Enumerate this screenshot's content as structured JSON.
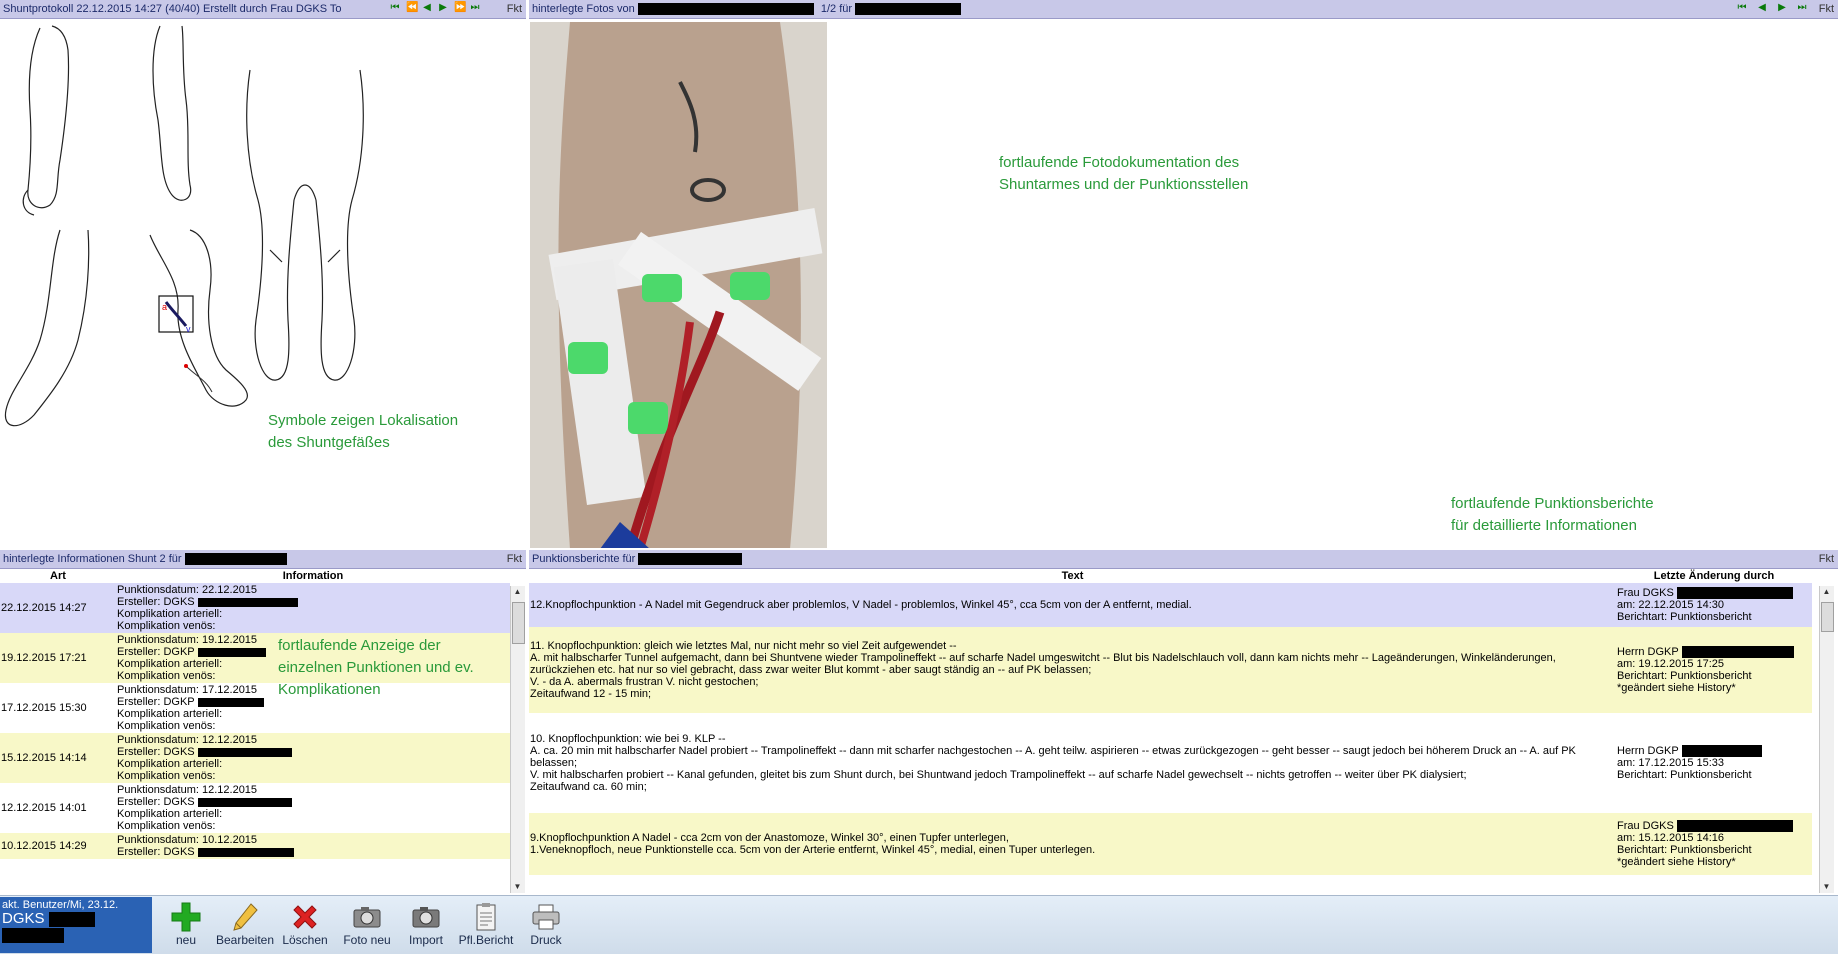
{
  "left_top": {
    "title": "Shuntprotokoll 22.12.2015 14:27 (40/40) Erstellt durch Frau DGKS To",
    "fkt": "Fkt",
    "annotation_line1": "Symbole zeigen Lokalisation",
    "annotation_line2": "des Shuntgefäßes"
  },
  "right_top": {
    "title_prefix": "hinterlegte Fotos von",
    "title_page": "1/2 für",
    "fkt": "Fkt",
    "annotation1_line1": "fortlaufende Fotodokumentation des",
    "annotation1_line2": "Shuntarmes und der Punktionsstellen",
    "annotation2_line1": "fortlaufende Punktionsberichte",
    "annotation2_line2": "für detaillierte Informationen"
  },
  "left_bottom": {
    "title": "hinterlegte Informationen Shunt 2 für",
    "fkt": "Fkt",
    "col_art": "Art",
    "col_info": "Information",
    "annotation_line1": "fortlaufende Anzeige der",
    "annotation_line2": "einzelnen Punktionen und ev.",
    "annotation_line3": "Komplikationen",
    "rows": [
      {
        "art": "22.12.2015 14:27",
        "l1": "Punktionsdatum: 22.12.2015",
        "l2": "Ersteller: DGKS",
        "l3": "Komplikation arteriell:",
        "l4": "Komplikation venös:"
      },
      {
        "art": "19.12.2015 17:21",
        "l1": "Punktionsdatum: 19.12.2015",
        "l2": "Ersteller: DGKP",
        "l3": "Komplikation arteriell:",
        "l4": "Komplikation venös:"
      },
      {
        "art": "17.12.2015 15:30",
        "l1": "Punktionsdatum: 17.12.2015",
        "l2": "Ersteller: DGKP",
        "l3": "Komplikation arteriell:",
        "l4": "Komplikation venös:"
      },
      {
        "art": "15.12.2015 14:14",
        "l1": "Punktionsdatum: 12.12.2015",
        "l2": "Ersteller: DGKS",
        "l3": "Komplikation arteriell:",
        "l4": "Komplikation venös:"
      },
      {
        "art": "12.12.2015 14:01",
        "l1": "Punktionsdatum: 12.12.2015",
        "l2": "Ersteller: DGKS",
        "l3": "Komplikation arteriell:",
        "l4": "Komplikation venös:"
      },
      {
        "art": "10.12.2015 14:29",
        "l1": "Punktionsdatum: 10.12.2015",
        "l2": "Ersteller: DGKS",
        "l3": "",
        "l4": ""
      }
    ]
  },
  "right_bottom": {
    "title": "Punktionsberichte für",
    "fkt": "Fkt",
    "col_text": "Text",
    "col_change": "Letzte Änderung durch",
    "rows": [
      {
        "text": "12.Knopflochpunktion - A Nadel mit Gegendruck aber problemlos, V Nadel - problemlos, Winkel 45°, cca 5cm von der A entfernt, medial.",
        "m1": "Frau DGKS",
        "m2": "am: 22.12.2015 14:30",
        "m3": "Berichtart: Punktionsbericht",
        "m4": ""
      },
      {
        "text": "11. Knopflochpunktion: gleich wie letztes Mal, nur nicht mehr so viel Zeit aufgewendet --\nA. mit halbscharfer Tunnel aufgemacht, dann bei Shuntvene wieder Trampolineffekt -- auf scharfe Nadel umgeswitcht -- Blut bis Nadelschlauch voll, dann kam nichts mehr -- Lageänderungen, Winkeländerungen, zurückziehen etc. hat nur so viel gebracht, dass zwar weiter Blut kommt - aber saugt ständig an -- auf PK belassen;\nV. - da A. abermals frustran V. nicht gestochen;\nZeitaufwand 12 - 15 min;",
        "m1": "Herrn DGKP",
        "m2": "am: 19.12.2015 17:25",
        "m3": "Berichtart: Punktionsbericht",
        "m4": "*geändert siehe History*"
      },
      {
        "text": "10. Knopflochpunktion: wie bei 9. KLP --\nA. ca. 20 min mit halbscharfer Nadel probiert -- Trampolineffekt -- dann mit scharfer nachgestochen -- A. geht teilw. aspirieren -- etwas zurückgezogen -- geht besser -- saugt jedoch bei höherem Druck an -- A. auf PK belassen;\nV. mit halbscharfen probiert -- Kanal gefunden, gleitet bis zum Shunt durch, bei Shuntwand jedoch Trampolineffekt -- auf scharfe Nadel gewechselt -- nichts getroffen -- weiter über PK dialysiert;\nZeitaufwand ca. 60 min;",
        "m1": "Herrn DGKP",
        "m2": "am: 17.12.2015 15:33",
        "m3": "Berichtart: Punktionsbericht",
        "m4": ""
      },
      {
        "text": "9.Knopflochpunktion A Nadel  -  cca 2cm von der Anastomoze, Winkel 30°, einen Tupfer unterlegen,\n1.Veneknopfloch, neue Punktionstelle cca. 5cm von der Arterie entfernt, Winkel 45°, medial, einen Tuper unterlegen.",
        "m1": "Frau DGKS",
        "m2": "am: 15.12.2015 14:16",
        "m3": "Berichtart: Punktionsbericht",
        "m4": "*geändert siehe History*"
      }
    ]
  },
  "toolbar": {
    "user_line1": "akt. Benutzer/Mi, 23.12.",
    "user_line2": "DGKS",
    "neu": "neu",
    "bearbeiten": "Bearbeiten",
    "loeschen": "Löschen",
    "foto_neu": "Foto neu",
    "import": "Import",
    "pfl_bericht": "Pfl.Bericht",
    "druck": "Druck",
    "colors": {
      "add": "#22aa22",
      "delete": "#dd2222",
      "user_bg": "#2a62b4"
    }
  },
  "icons": [
    "first-icon",
    "prev-prev-icon",
    "prev-icon",
    "next-icon",
    "next-next-icon",
    "last-icon",
    "plus-icon",
    "pencil-icon",
    "x-icon",
    "camera-icon",
    "import-camera-icon",
    "clipboard-icon",
    "printer-icon"
  ]
}
